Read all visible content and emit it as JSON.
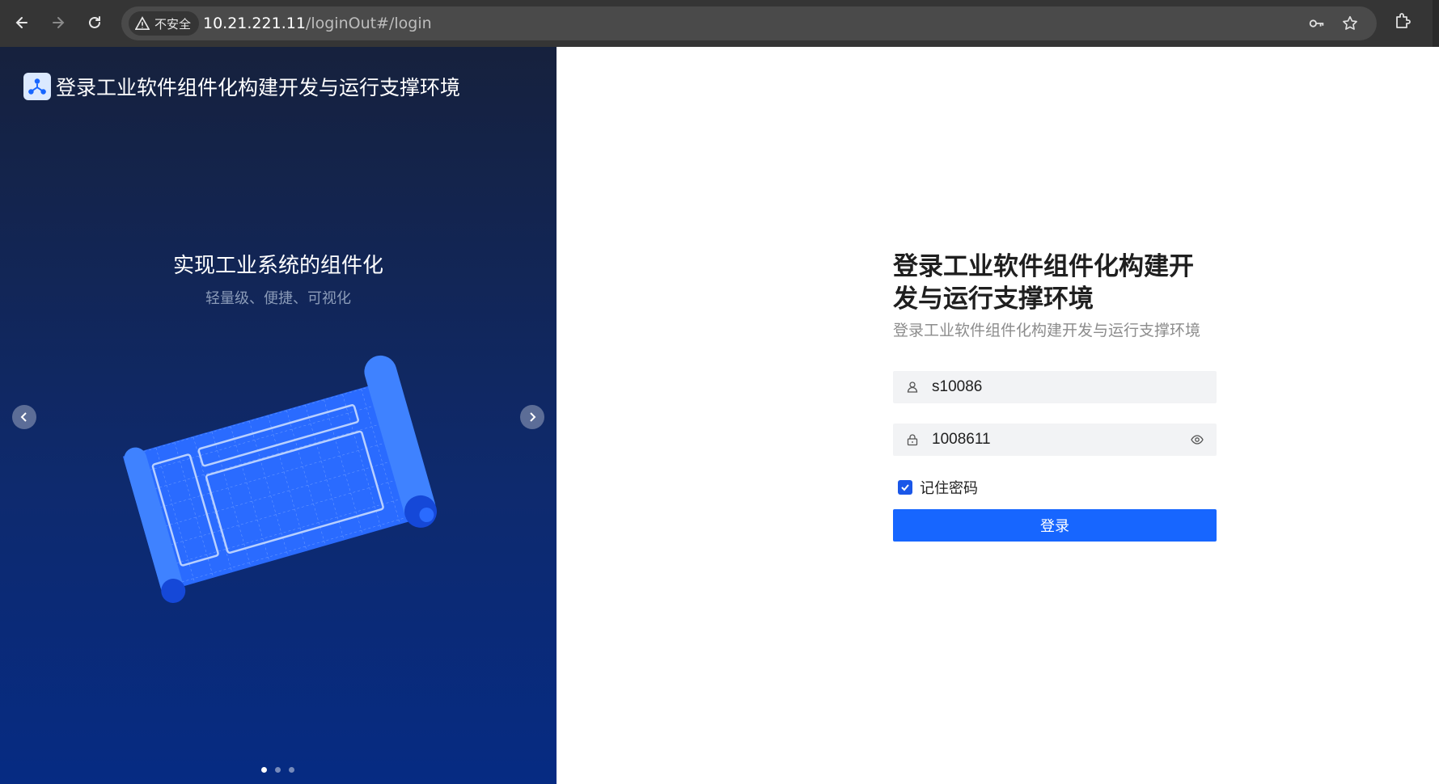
{
  "browser": {
    "security_label": "不安全",
    "url_host": "10.21.221.11",
    "url_path": "/loginOut#/login",
    "icons": [
      "back-icon",
      "forward-icon",
      "reload-icon",
      "warning-icon",
      "key-icon",
      "star-icon",
      "extensions-icon"
    ]
  },
  "left_panel": {
    "brand_title": "登录工业软件组件化构建开发与运行支撑环境",
    "slide": {
      "title": "实现工业系统的组件化",
      "subtitle": "轻量级、便捷、可视化"
    },
    "carousel_count": 3,
    "carousel_active": 0
  },
  "login": {
    "title": "登录工业软件组件化构建开发与运行支撑环境",
    "subtitle": "登录工业软件组件化构建开发与运行支撑环境",
    "username": "s10086",
    "password": "1008611",
    "remember_label": "记住密码",
    "remember_checked": true,
    "submit_label": "登录"
  },
  "colors": {
    "primary": "#1766ff",
    "panel_top": "#16213d",
    "panel_bottom": "#062b83",
    "input_bg": "#f2f3f5"
  }
}
